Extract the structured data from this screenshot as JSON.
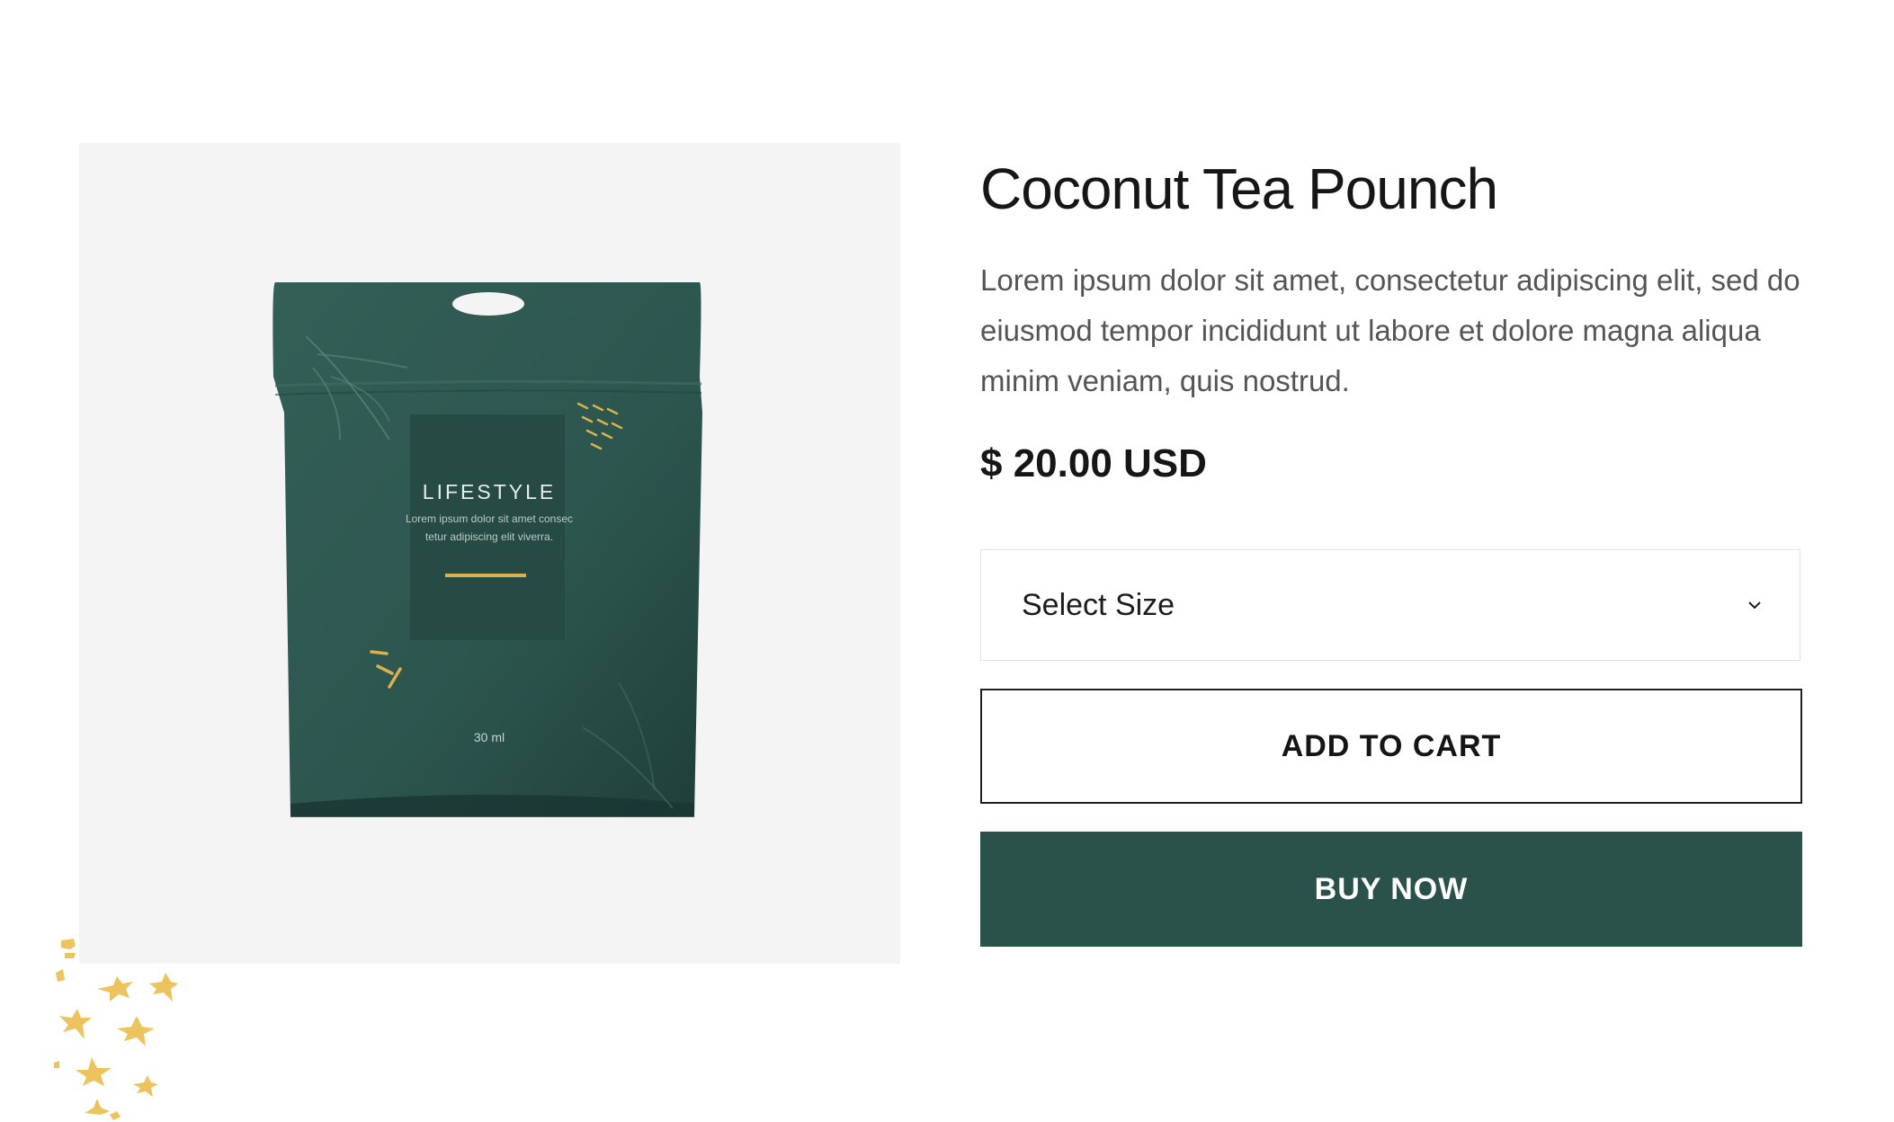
{
  "product": {
    "title": "Coconut Tea Pounch",
    "description": "Lorem ipsum dolor sit amet, consectetur adipiscing elit, sed do eiusmod tempor incididunt ut labore et dolore magna aliqua minim veniam, quis nostrud.",
    "price": "$ 20.00 USD",
    "image": {
      "brand": "LIFESTYLE",
      "desc_line1": "Lorem ipsum dolor sit amet consec",
      "desc_line2": "tetur adipiscing elit viverra.",
      "volume": "30 ml"
    }
  },
  "size_select": {
    "selected": "Select Size",
    "icon": "chevron-down-icon"
  },
  "actions": {
    "add_to_cart": "ADD TO CART",
    "buy_now": "BUY NOW"
  },
  "colors": {
    "accent": "#2a514a",
    "pouch": "#2f5a52",
    "decor": "#ecc35c",
    "image_bg": "#f4f4f4"
  }
}
